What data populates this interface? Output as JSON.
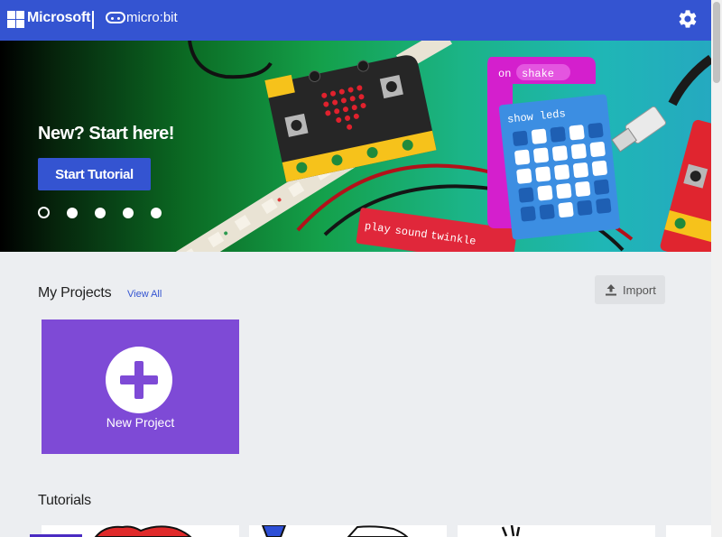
{
  "header": {
    "brand": "Microsoft",
    "product": "micro:bit",
    "settings_icon": "gear-icon",
    "colors": {
      "bar": "#3454d1"
    }
  },
  "hero": {
    "title": "New? Start here!",
    "button_label": "Start Tutorial",
    "carousel": {
      "count": 5,
      "active_index": 1
    },
    "illustration_text": {
      "on_label": "on",
      "event_label": "shake",
      "show_leds_label": "show leds",
      "play_label": "play",
      "sound_label": "sound",
      "twinkle_label": "twinkle"
    }
  },
  "projects": {
    "title": "My Projects",
    "view_all": "View All",
    "import_label": "Import",
    "new_project_label": "New Project"
  },
  "tutorials": {
    "title": "Tutorials"
  },
  "colors": {
    "primary": "#3454d1",
    "new_project_card": "#7e4ad6",
    "page_bg": "#eceef1"
  }
}
